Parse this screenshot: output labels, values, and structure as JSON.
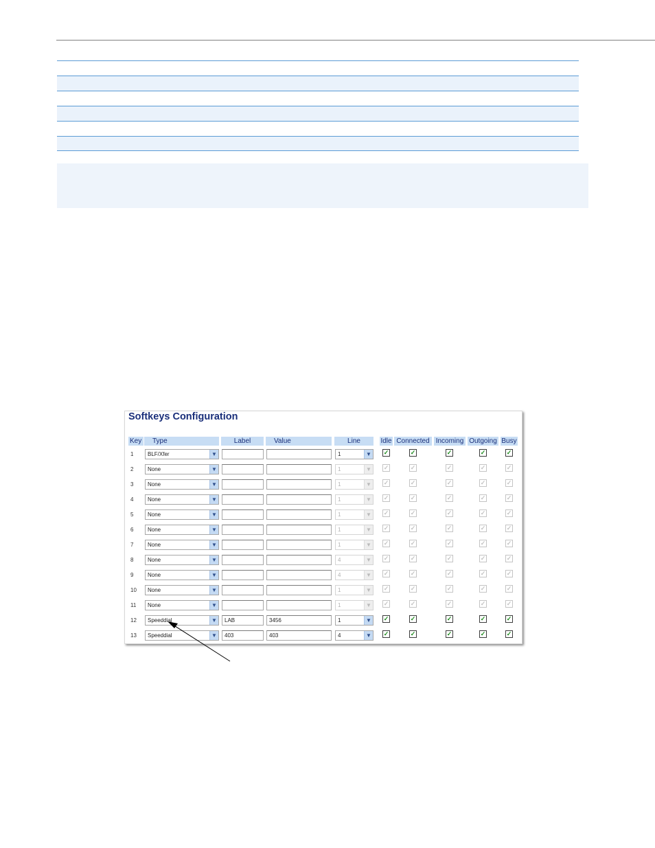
{
  "panel": {
    "title": "Softkeys Configuration",
    "headers": {
      "key": "Key",
      "type": "Type",
      "label": "Label",
      "value": "Value",
      "line": "Line",
      "idle": "Idle",
      "connected": "Connected",
      "incoming": "Incoming",
      "outgoing": "Outgoing",
      "busy": "Busy"
    },
    "rows": [
      {
        "key": "1",
        "type": "BLF/Xfer",
        "label": "",
        "value": "",
        "line": "1",
        "enabled": true,
        "idle": true,
        "connected": true,
        "incoming": true,
        "outgoing": true,
        "busy": true
      },
      {
        "key": "2",
        "type": "None",
        "label": "",
        "value": "",
        "line": "1",
        "enabled": false,
        "idle": true,
        "connected": true,
        "incoming": true,
        "outgoing": true,
        "busy": true
      },
      {
        "key": "3",
        "type": "None",
        "label": "",
        "value": "",
        "line": "1",
        "enabled": false,
        "idle": true,
        "connected": true,
        "incoming": true,
        "outgoing": true,
        "busy": true
      },
      {
        "key": "4",
        "type": "None",
        "label": "",
        "value": "",
        "line": "1",
        "enabled": false,
        "idle": true,
        "connected": true,
        "incoming": true,
        "outgoing": true,
        "busy": true
      },
      {
        "key": "5",
        "type": "None",
        "label": "",
        "value": "",
        "line": "1",
        "enabled": false,
        "idle": true,
        "connected": true,
        "incoming": true,
        "outgoing": true,
        "busy": true
      },
      {
        "key": "6",
        "type": "None",
        "label": "",
        "value": "",
        "line": "1",
        "enabled": false,
        "idle": true,
        "connected": true,
        "incoming": true,
        "outgoing": true,
        "busy": true
      },
      {
        "key": "7",
        "type": "None",
        "label": "",
        "value": "",
        "line": "1",
        "enabled": false,
        "idle": true,
        "connected": true,
        "incoming": true,
        "outgoing": true,
        "busy": true
      },
      {
        "key": "8",
        "type": "None",
        "label": "",
        "value": "",
        "line": "4",
        "enabled": false,
        "idle": true,
        "connected": true,
        "incoming": true,
        "outgoing": true,
        "busy": true
      },
      {
        "key": "9",
        "type": "None",
        "label": "",
        "value": "",
        "line": "4",
        "enabled": false,
        "idle": true,
        "connected": true,
        "incoming": true,
        "outgoing": true,
        "busy": true
      },
      {
        "key": "10",
        "type": "None",
        "label": "",
        "value": "",
        "line": "1",
        "enabled": false,
        "idle": true,
        "connected": true,
        "incoming": true,
        "outgoing": true,
        "busy": true
      },
      {
        "key": "11",
        "type": "None",
        "label": "",
        "value": "",
        "line": "1",
        "enabled": false,
        "idle": true,
        "connected": true,
        "incoming": true,
        "outgoing": true,
        "busy": true
      },
      {
        "key": "12",
        "type": "Speeddial",
        "label": "LAB",
        "value": "3456",
        "line": "1",
        "enabled": true,
        "idle": true,
        "connected": true,
        "incoming": true,
        "outgoing": true,
        "busy": true
      },
      {
        "key": "13",
        "type": "Speeddial",
        "label": "403",
        "value": "403",
        "line": "4",
        "enabled": true,
        "idle": true,
        "connected": true,
        "incoming": true,
        "outgoing": true,
        "busy": true
      }
    ]
  },
  "colors": {
    "title": "#1a2f7a",
    "header_bg": "#c7ddf4",
    "check_on": "#1e8b1e",
    "table_rule": "#5b9bd5"
  }
}
